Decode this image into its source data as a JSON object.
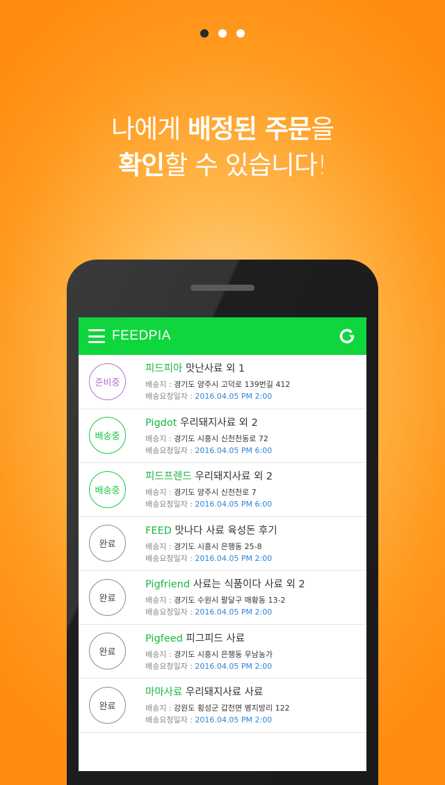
{
  "pager": {
    "count": 3,
    "active_index": 0
  },
  "headline": {
    "line1_a": "나에게 ",
    "line1_b": "배정된 주문",
    "line1_c": "을",
    "line2_a": "확인",
    "line2_b": "할 수 있습니다!"
  },
  "app": {
    "title": "FEEDPIA",
    "menu_icon": "hamburger-menu-icon",
    "refresh_icon": "refresh-icon",
    "accent_color": "#0fd63d"
  },
  "labels": {
    "address": "배송지 : ",
    "requested": "배송요청일자 : "
  },
  "orders": [
    {
      "status": "준비중",
      "status_kind": "prep",
      "name": "피드피아",
      "product": "맛난사료  외 1",
      "address": "경기도 양주시 고덕로 139번길 412",
      "date": "2016.04.05 PM 2:00"
    },
    {
      "status": "배송중",
      "status_kind": "ship",
      "name": "Pigdot",
      "product": "우리돼지사료  외 2",
      "address": "경기도 시흥시 신천천동로 72",
      "date": "2016.04.05 PM 6:00"
    },
    {
      "status": "배송중",
      "status_kind": "ship",
      "name": "피드프렌드",
      "product": "우리돼지사료  외 2",
      "address": "경기도 양주시 신천천로 7",
      "date": "2016.04.05 PM 6:00"
    },
    {
      "status": "완료",
      "status_kind": "done",
      "name": "FEED",
      "product": "맛나다 사료 육성돈 후기",
      "address": "경기도 시흥시 은행동 25-8",
      "date": "2016.04.05 PM 2:00"
    },
    {
      "status": "완료",
      "status_kind": "done",
      "name": "Pigfriend",
      "product": "사료는 식품이다 사료 외 2",
      "address": "경기도 수원시 팔달구 매황동 13-2",
      "date": "2016.04.05 PM 2:00"
    },
    {
      "status": "완료",
      "status_kind": "done",
      "name": "Pigfeed",
      "product": "피그피드 사료",
      "address": "경기도 시흥시 은행동 우남농가",
      "date": "2016.04.05 PM 2:00"
    },
    {
      "status": "완료",
      "status_kind": "done",
      "name": "마마사료",
      "product": "우리돼지사료  사료",
      "address": "강원도 횡성군 갑천면 병지방리 122",
      "date": "2016.04.05 PM 2:00"
    }
  ]
}
